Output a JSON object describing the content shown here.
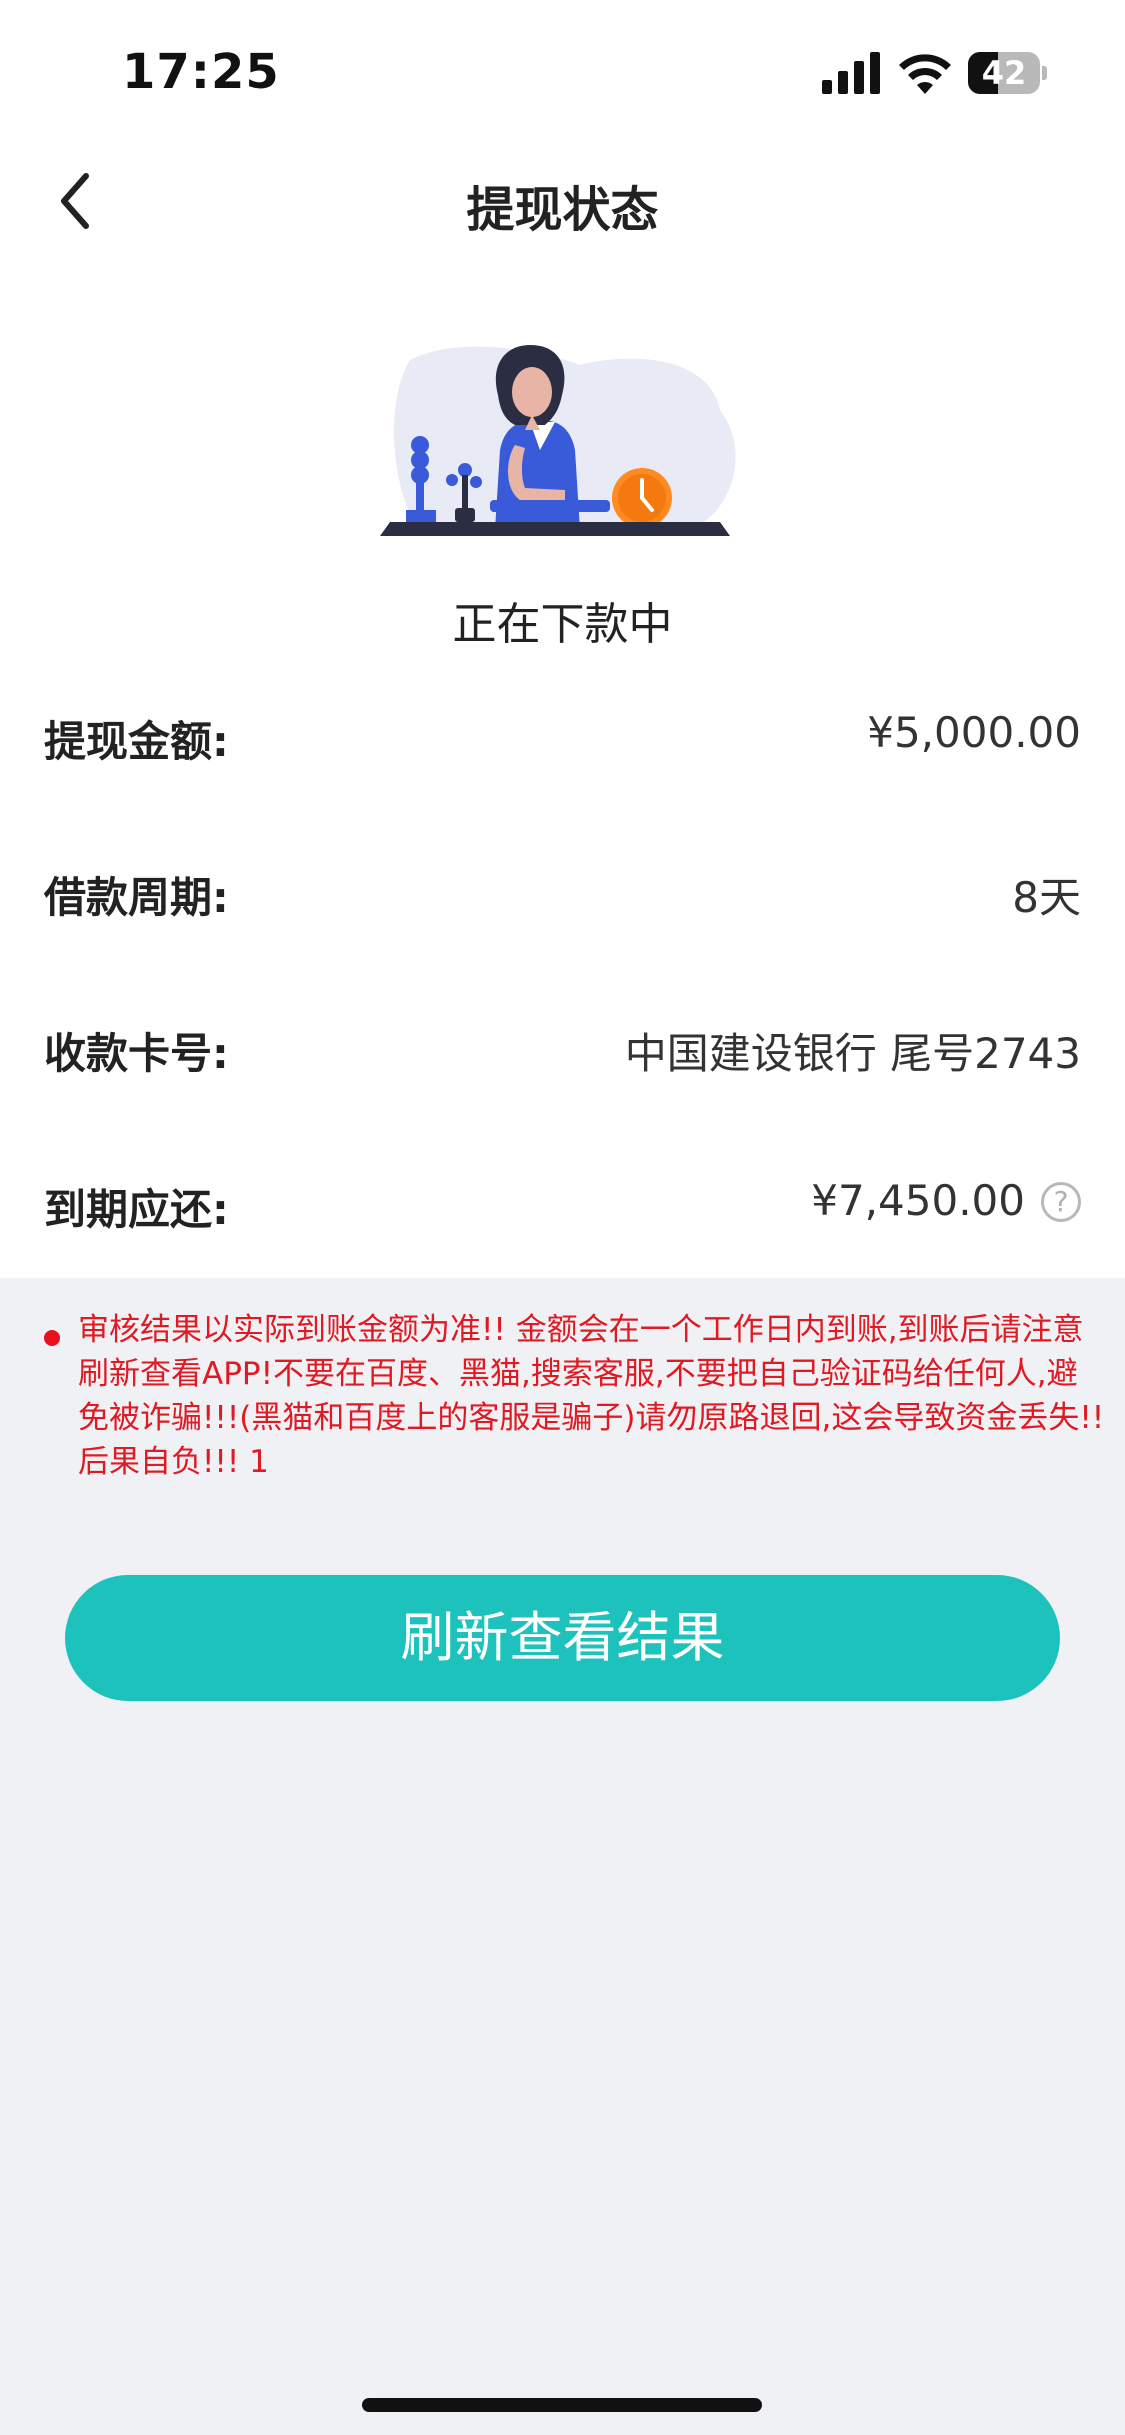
{
  "status_bar": {
    "time": "17:25",
    "battery": "42",
    "battery_level": 0.42
  },
  "header": {
    "title": "提现状态"
  },
  "status": {
    "text": "正在下款中"
  },
  "details": [
    {
      "label": "提现金额:",
      "value": "¥5,000.00"
    },
    {
      "label": "借款周期:",
      "value": "8天"
    },
    {
      "label": "收款卡号:",
      "value": "中国建设银行 尾号2743"
    },
    {
      "label": "到期应还:",
      "value": "¥7,450.00",
      "help_icon": "?"
    }
  ],
  "notice": {
    "text": "审核结果以实际到账金额为准!! 金额会在一个工作日内到账,到账后请注意刷新查看APP!不要在百度、黑猫,搜索客服,不要把自己验证码给任何人,避免被诈骗!!!(黑猫和百度上的客服是骗子)请勿原路退回,这会导致资金丢失!!后果自负!!! 1",
    "color": "#e01a22"
  },
  "actions": {
    "refresh_label": "刷新查看结果"
  },
  "colors": {
    "accent": "#1dc2bd",
    "warning": "#e8101d",
    "background": "#f0f1f5"
  }
}
